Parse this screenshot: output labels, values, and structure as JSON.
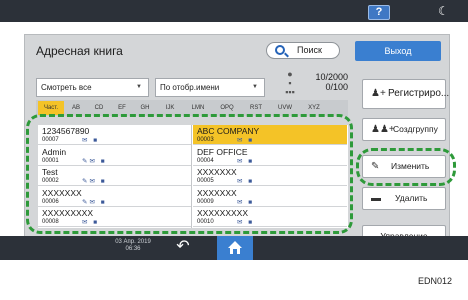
{
  "device": {
    "help_label": "?",
    "datetime_line1": "03 Апр. 2019",
    "datetime_line2": "06:36",
    "back_glyph": "↶",
    "footer_code": "EDN012"
  },
  "header": {
    "title": "Адресная книга",
    "search_label": "Поиск",
    "exit_label": "Выход"
  },
  "filters": {
    "view_value": "Смотреть все",
    "sort_value": "По отобр.имени"
  },
  "counts": {
    "registered": "10/2000",
    "selected": "0/100"
  },
  "index_tabs": [
    {
      "label": "Част.",
      "active": true
    },
    {
      "label": "AB",
      "active": false
    },
    {
      "label": "CD",
      "active": false
    },
    {
      "label": "EF",
      "active": false
    },
    {
      "label": "GH",
      "active": false
    },
    {
      "label": "IJK",
      "active": false
    },
    {
      "label": "LMN",
      "active": false
    },
    {
      "label": "OPQ",
      "active": false
    },
    {
      "label": "RST",
      "active": false
    },
    {
      "label": "UVW",
      "active": false
    },
    {
      "label": "XYZ",
      "active": false
    }
  ],
  "side_buttons": {
    "register": "Регистриро...",
    "create_group": "Создгруппу",
    "edit": "Изменить",
    "delete": "Удалить",
    "manage": "Управление"
  },
  "entries": {
    "left": [
      {
        "name": "1234567890",
        "number": "00007",
        "icons": "✉ ■"
      },
      {
        "name": "Admin",
        "number": "00001",
        "icons": "✎✉ ■"
      },
      {
        "name": "Test",
        "number": "00002",
        "icons": "✎✉ ■"
      },
      {
        "name": "XXXXXXX",
        "number": "00006",
        "icons": "✎✉ ■"
      },
      {
        "name": "XXXXXXXXX",
        "number": "00008",
        "icons": "✉ ■"
      }
    ],
    "right": [
      {
        "name": "ABC COMPANY",
        "number": "00003",
        "icons": "✉ ■",
        "selected": true
      },
      {
        "name": "DEF OFFICE",
        "number": "00004",
        "icons": "✉ ■",
        "selected": false
      },
      {
        "name": "XXXXXXX",
        "number": "00005",
        "icons": "✉ ■",
        "selected": false
      },
      {
        "name": "XXXXXXX",
        "number": "00009",
        "icons": "✉ ■",
        "selected": false
      },
      {
        "name": "XXXXXXXXX",
        "number": "00010",
        "icons": "✉ ■",
        "selected": false
      }
    ]
  },
  "colors": {
    "accent_blue": "#3a7fd0",
    "selected_yellow": "#f4c327",
    "annotation_green": "#2e9a3a"
  }
}
